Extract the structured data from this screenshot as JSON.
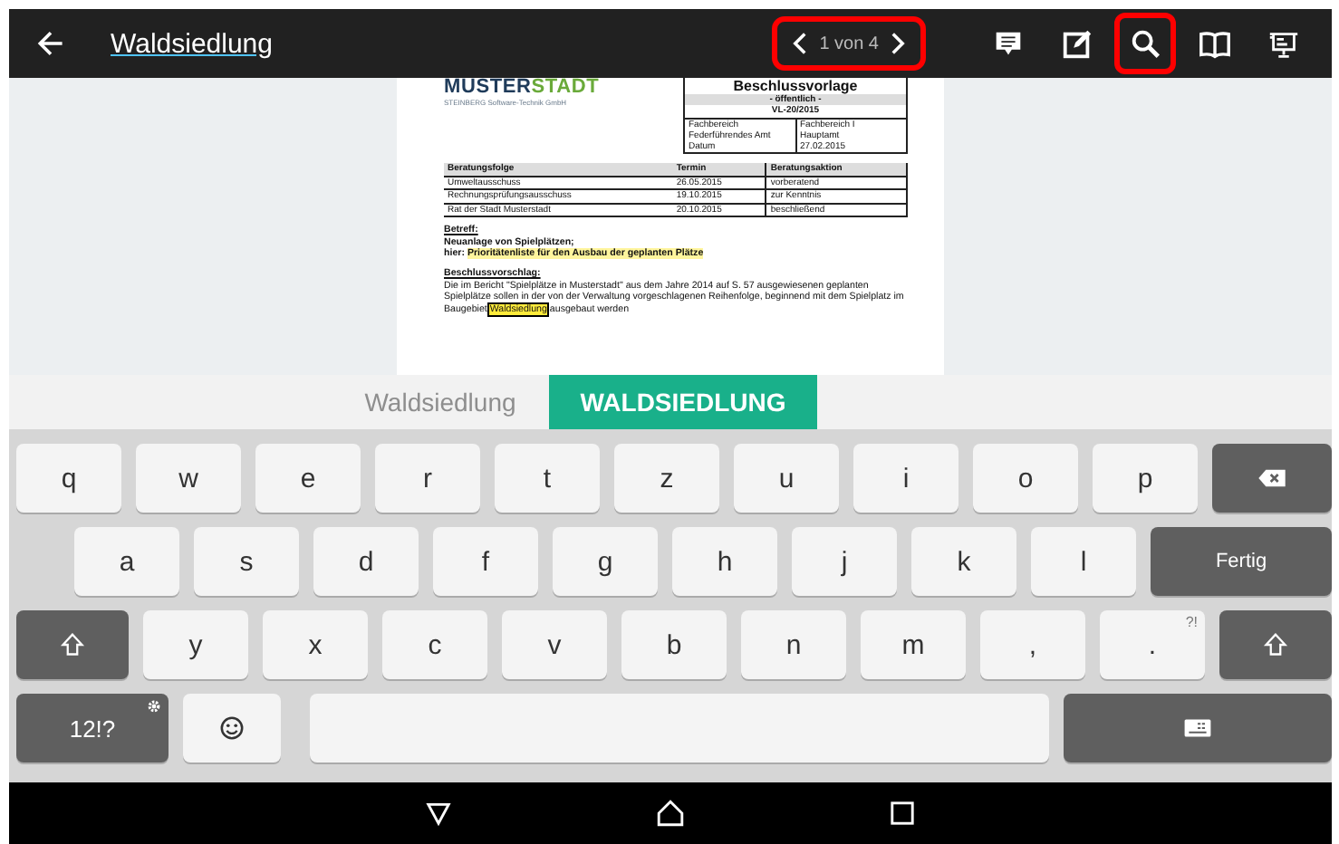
{
  "top_bar": {
    "title": "Waldsiedlung",
    "pager": {
      "label": "1 von 4",
      "highlighted": true
    },
    "actions": [
      {
        "kind": "comment",
        "highlighted": false
      },
      {
        "kind": "edit",
        "highlighted": false
      },
      {
        "kind": "search",
        "highlighted": true
      },
      {
        "kind": "book",
        "highlighted": false
      },
      {
        "kind": "present",
        "highlighted": false
      }
    ]
  },
  "document": {
    "logo": {
      "primary": "MUSTER",
      "accent": "STADT"
    },
    "logo_subtitle": "STEINBERG Software-Technik GmbH",
    "header": {
      "title": "Beschlussvorlage",
      "visibility": "- öffentlich -",
      "number": "VL-20/2015",
      "fields": [
        {
          "label": "Fachbereich",
          "value": "Fachbereich I"
        },
        {
          "label": "Federführendes Amt",
          "value": "Hauptamt"
        },
        {
          "label": "Datum",
          "value": "27.02.2015"
        }
      ]
    },
    "table": {
      "columns": [
        "Beratungsfolge",
        "Termin",
        "Beratungsaktion"
      ],
      "rows": [
        [
          "Umweltausschuss",
          "26.05.2015",
          "vorberatend"
        ],
        [
          "Rechnungsprüfungsausschuss",
          "19.10.2015",
          "zur Kenntnis"
        ],
        [
          "Rat der Stadt Musterstadt",
          "20.10.2015",
          "beschließend"
        ]
      ]
    },
    "subject_heading": "Betreff:",
    "subject_line": "Neuanlage von Spielplätzen;",
    "subject_detail": [
      {
        "text": "hier: ",
        "highlighted": false
      },
      {
        "text": "Prioritätenliste für den Ausbau der geplanten Plätze",
        "highlighted": true
      }
    ],
    "proposal_heading": "Beschlussvorschlag:",
    "proposal": [
      {
        "text": "Die im Bericht \"Spielplätze in Musterstadt\" aus dem Jahre 2014 auf S. 57 ausgewiesenen geplanten Spielplätze sollen in der von der Verwaltung vorgeschlagenen Reihenfolge, beginnend mit dem Spielplatz im Baugebiet ",
        "highlighted": false
      },
      {
        "text": "Waldsiedlung",
        "highlighted": true,
        "current": true
      },
      {
        "text": " ausgebaut werden",
        "highlighted": false
      }
    ]
  },
  "suggestions": [
    {
      "text": "Waldsiedlung",
      "selected": false
    },
    {
      "text": "WALDSIEDLUNG",
      "selected": true
    }
  ],
  "keyboard": [
    [
      {
        "kind": "letter",
        "label": "q"
      },
      {
        "kind": "letter",
        "label": "w"
      },
      {
        "kind": "letter",
        "label": "e"
      },
      {
        "kind": "letter",
        "label": "r"
      },
      {
        "kind": "letter",
        "label": "t"
      },
      {
        "kind": "letter",
        "label": "z"
      },
      {
        "kind": "letter",
        "label": "u"
      },
      {
        "kind": "letter",
        "label": "i"
      },
      {
        "kind": "letter",
        "label": "o"
      },
      {
        "kind": "letter",
        "label": "p"
      },
      {
        "kind": "backspace"
      }
    ],
    [
      {
        "kind": "letter",
        "label": "a"
      },
      {
        "kind": "letter",
        "label": "s"
      },
      {
        "kind": "letter",
        "label": "d"
      },
      {
        "kind": "letter",
        "label": "f"
      },
      {
        "kind": "letter",
        "label": "g"
      },
      {
        "kind": "letter",
        "label": "h"
      },
      {
        "kind": "letter",
        "label": "j"
      },
      {
        "kind": "letter",
        "label": "k"
      },
      {
        "kind": "letter",
        "label": "l"
      },
      {
        "kind": "enter",
        "label": "Fertig"
      }
    ],
    [
      {
        "kind": "shift"
      },
      {
        "kind": "letter",
        "label": "y"
      },
      {
        "kind": "letter",
        "label": "x"
      },
      {
        "kind": "letter",
        "label": "c"
      },
      {
        "kind": "letter",
        "label": "v"
      },
      {
        "kind": "letter",
        "label": "b"
      },
      {
        "kind": "letter",
        "label": "n"
      },
      {
        "kind": "letter",
        "label": "m"
      },
      {
        "kind": "letter",
        "label": ","
      },
      {
        "kind": "letter",
        "label": ".",
        "hint": "?!"
      },
      {
        "kind": "shift"
      }
    ],
    [
      {
        "kind": "symbols",
        "label": "12!?"
      },
      {
        "kind": "emoji"
      },
      {
        "kind": "space"
      },
      {
        "kind": "hide"
      }
    ]
  ],
  "nav_bar": [
    {
      "kind": "back"
    },
    {
      "kind": "home"
    },
    {
      "kind": "recents"
    }
  ]
}
